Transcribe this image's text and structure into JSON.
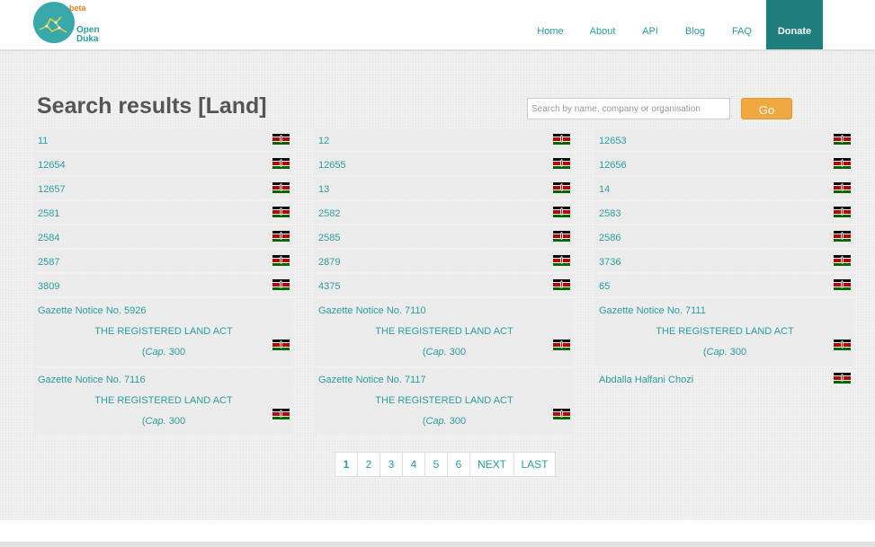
{
  "brand": {
    "beta": "beta",
    "name_line1": "Open",
    "name_line2": "Duka"
  },
  "nav": {
    "home": "Home",
    "about": "About",
    "api": "API",
    "blog": "Blog",
    "faq": "FAQ",
    "donate": "Donate"
  },
  "colors": {
    "accent": "#2a9d9f",
    "donate_bg": "#1f7d7d",
    "go_button": "#f0a941"
  },
  "page_title": "Search results [Land]",
  "search": {
    "placeholder": "Search by name, company or organisation",
    "button": "Go"
  },
  "columns": [
    {
      "simple": [
        "11",
        "12654",
        "12657",
        "2581",
        "2584",
        "2587",
        "3809"
      ],
      "gazettes": [
        {
          "title": "Gazette Notice No. 5926",
          "act": "THE REGISTERED LAND ACT",
          "cap_prefix": "(",
          "cap_italic": "Cap.",
          "cap_number": " 300"
        },
        {
          "title": "Gazette Notice No. 7116",
          "act": "THE REGISTERED LAND ACT",
          "cap_prefix": "(",
          "cap_italic": "Cap.",
          "cap_number": " 300"
        }
      ]
    },
    {
      "simple": [
        "12",
        "12655",
        "13",
        "2582",
        "2585",
        "2879",
        "4375"
      ],
      "gazettes": [
        {
          "title": "Gazette Notice No. 7110",
          "act": "THE REGISTERED LAND ACT",
          "cap_prefix": "(",
          "cap_italic": "Cap.",
          "cap_number": " 300"
        },
        {
          "title": "Gazette Notice No. 7117",
          "act": "THE REGISTERED LAND ACT",
          "cap_prefix": "(",
          "cap_italic": "Cap.",
          "cap_number": " 300"
        }
      ]
    },
    {
      "simple": [
        "12653",
        "12656",
        "14",
        "2583",
        "2586",
        "3736",
        "65"
      ],
      "gazettes": [
        {
          "title": "Gazette Notice No. 7111",
          "act": "THE REGISTERED LAND ACT",
          "cap_prefix": "(",
          "cap_italic": "Cap.",
          "cap_number": " 300"
        }
      ],
      "extra": "Abdalla Halfani Chozi"
    }
  ],
  "pagination": {
    "pages": [
      "1",
      "2",
      "3",
      "4",
      "5",
      "6"
    ],
    "current": "1",
    "next": "NEXT",
    "last": "LAST"
  }
}
